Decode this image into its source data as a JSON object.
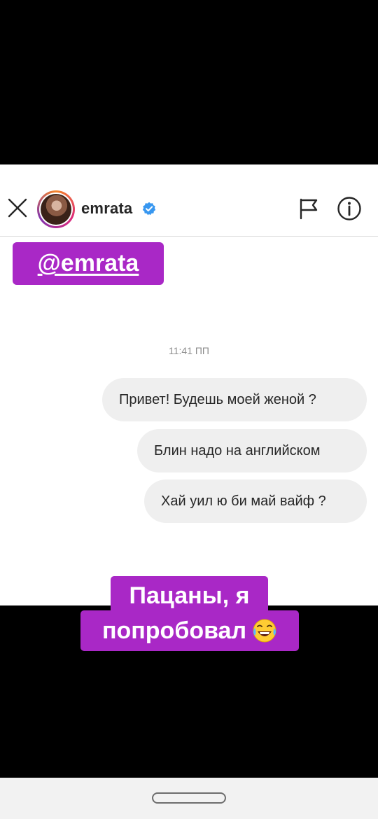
{
  "header": {
    "username": "emrata",
    "icons": {
      "close": "close-icon",
      "verified": "verified-badge-icon",
      "flag": "flag-icon",
      "info": "info-icon"
    }
  },
  "sticker": {
    "mention": "@emrata"
  },
  "conversation": {
    "timestamp": "11:41 ПП",
    "messages": [
      {
        "text": "Привет! Будешь моей женой ?"
      },
      {
        "text": "Блин надо на английском"
      },
      {
        "text": "Хай уил ю би май вайф ?"
      }
    ]
  },
  "caption": {
    "line1": "Пацаны, я",
    "line2": "попробовал",
    "emoji": "face-with-tears-of-joy"
  },
  "colors": {
    "sticker_bg": "#a928c6",
    "bubble_bg": "#efefef",
    "verified_blue": "#3897f0"
  }
}
